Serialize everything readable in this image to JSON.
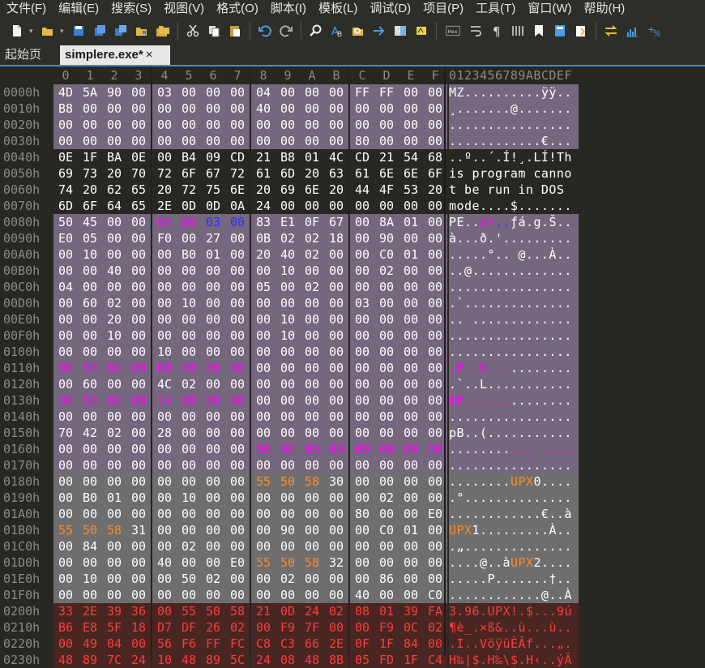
{
  "menu": [
    "文件(F)",
    "编辑(E)",
    "搜索(S)",
    "视图(V)",
    "格式(O)",
    "脚本(I)",
    "模板(L)",
    "调试(D)",
    "项目(P)",
    "工具(T)",
    "窗口(W)",
    "帮助(H)"
  ],
  "toolbar": {
    "items": [
      "new-file",
      "open-folder",
      "save",
      "save-as",
      "save-all",
      "open-project",
      "open-multiple",
      "cut",
      "copy",
      "paste",
      "undo",
      "redo",
      "find",
      "find-replace",
      "find-in-files",
      "goto",
      "compare",
      "highlight",
      "hex-mode",
      "word-wrap",
      "pilcrow",
      "columns",
      "bookmark",
      "calculator",
      "clipboard",
      "swap",
      "histogram",
      "checksum"
    ],
    "hex_label": "Hex"
  },
  "tabs": [
    {
      "label": "起始页",
      "active": false
    },
    {
      "label": "simplere.exe*",
      "active": true,
      "close": "×"
    }
  ],
  "hex": {
    "columns": [
      "0",
      "1",
      "2",
      "3",
      "4",
      "5",
      "6",
      "7",
      "8",
      "9",
      "A",
      "B",
      "C",
      "D",
      "E",
      "F"
    ],
    "ascii_header": "0123456789ABCDEF",
    "rows": [
      {
        "addr": "0000h",
        "bytes": [
          "4D",
          "5A",
          "90",
          "00",
          "03",
          "00",
          "00",
          "00",
          "04",
          "00",
          "00",
          "00",
          "FF",
          "FF",
          "00",
          "00"
        ],
        "ascii": "MZ..........ÿÿ..",
        "bg": "p"
      },
      {
        "addr": "0010h",
        "bytes": [
          "B8",
          "00",
          "00",
          "00",
          "00",
          "00",
          "00",
          "00",
          "40",
          "00",
          "00",
          "00",
          "00",
          "00",
          "00",
          "00"
        ],
        "ascii": "¸.......@.......",
        "bg": "p"
      },
      {
        "addr": "0020h",
        "bytes": [
          "00",
          "00",
          "00",
          "00",
          "00",
          "00",
          "00",
          "00",
          "00",
          "00",
          "00",
          "00",
          "00",
          "00",
          "00",
          "00"
        ],
        "ascii": "................",
        "bg": "p"
      },
      {
        "addr": "0030h",
        "bytes": [
          "00",
          "00",
          "00",
          "00",
          "00",
          "00",
          "00",
          "00",
          "00",
          "00",
          "00",
          "00",
          "80",
          "00",
          "00",
          "00"
        ],
        "ascii": "............€...",
        "bg": "p"
      },
      {
        "addr": "0040h",
        "bytes": [
          "0E",
          "1F",
          "BA",
          "0E",
          "00",
          "B4",
          "09",
          "CD",
          "21",
          "B8",
          "01",
          "4C",
          "CD",
          "21",
          "54",
          "68"
        ],
        "ascii": "..º..´.Í!¸.LÍ!Th",
        "bg": "n"
      },
      {
        "addr": "0050h",
        "bytes": [
          "69",
          "73",
          "20",
          "70",
          "72",
          "6F",
          "67",
          "72",
          "61",
          "6D",
          "20",
          "63",
          "61",
          "6E",
          "6E",
          "6F"
        ],
        "ascii": "is program canno",
        "bg": "n"
      },
      {
        "addr": "0060h",
        "bytes": [
          "74",
          "20",
          "62",
          "65",
          "20",
          "72",
          "75",
          "6E",
          "20",
          "69",
          "6E",
          "20",
          "44",
          "4F",
          "53",
          "20"
        ],
        "ascii": "t be run in DOS ",
        "bg": "n"
      },
      {
        "addr": "0070h",
        "bytes": [
          "6D",
          "6F",
          "64",
          "65",
          "2E",
          "0D",
          "0D",
          "0A",
          "24",
          "00",
          "00",
          "00",
          "00",
          "00",
          "00",
          "00"
        ],
        "ascii": "mode....$.......",
        "bg": "n"
      },
      {
        "addr": "0080h",
        "bytes": [
          "50",
          "45",
          "00",
          "00",
          "64",
          "86",
          "03",
          "00",
          "83",
          "E1",
          "0F",
          "67",
          "00",
          "8A",
          "01",
          "00"
        ],
        "ascii": "PE..d†..ƒá.g.Š..",
        "bg": "p",
        "colors": {
          "4": "m",
          "5": "m",
          "6": "b",
          "7": "b"
        },
        "acolors": {
          "4": "m",
          "5": "m",
          "6": "b",
          "7": "b"
        }
      },
      {
        "addr": "0090h",
        "bytes": [
          "E0",
          "05",
          "00",
          "00",
          "F0",
          "00",
          "27",
          "00",
          "0B",
          "02",
          "02",
          "18",
          "00",
          "90",
          "00",
          "00"
        ],
        "ascii": "à...ð.'.........",
        "bg": "p"
      },
      {
        "addr": "00A0h",
        "bytes": [
          "00",
          "10",
          "00",
          "00",
          "00",
          "B0",
          "01",
          "00",
          "20",
          "40",
          "02",
          "00",
          "00",
          "C0",
          "01",
          "00"
        ],
        "ascii": ".....°.. @...À..",
        "bg": "p"
      },
      {
        "addr": "00B0h",
        "bytes": [
          "00",
          "00",
          "40",
          "00",
          "00",
          "00",
          "00",
          "00",
          "00",
          "10",
          "00",
          "00",
          "00",
          "02",
          "00",
          "00"
        ],
        "ascii": "..@.............",
        "bg": "p"
      },
      {
        "addr": "00C0h",
        "bytes": [
          "04",
          "00",
          "00",
          "00",
          "00",
          "00",
          "00",
          "00",
          "05",
          "00",
          "02",
          "00",
          "00",
          "00",
          "00",
          "00"
        ],
        "ascii": "................",
        "bg": "p"
      },
      {
        "addr": "00D0h",
        "bytes": [
          "00",
          "60",
          "02",
          "00",
          "00",
          "10",
          "00",
          "00",
          "00",
          "00",
          "00",
          "00",
          "03",
          "00",
          "00",
          "00"
        ],
        "ascii": ".`..............",
        "bg": "p"
      },
      {
        "addr": "00E0h",
        "bytes": [
          "00",
          "00",
          "20",
          "00",
          "00",
          "00",
          "00",
          "00",
          "00",
          "10",
          "00",
          "00",
          "00",
          "00",
          "00",
          "00"
        ],
        "ascii": ".. .............",
        "bg": "p"
      },
      {
        "addr": "00F0h",
        "bytes": [
          "00",
          "00",
          "10",
          "00",
          "00",
          "00",
          "00",
          "00",
          "00",
          "10",
          "00",
          "00",
          "00",
          "00",
          "00",
          "00"
        ],
        "ascii": "................",
        "bg": "p"
      },
      {
        "addr": "0100h",
        "bytes": [
          "00",
          "00",
          "00",
          "00",
          "10",
          "00",
          "00",
          "00",
          "00",
          "00",
          "00",
          "00",
          "00",
          "00",
          "00",
          "00"
        ],
        "ascii": "................",
        "bg": "p"
      },
      {
        "addr": "0110h",
        "bytes": [
          "00",
          "50",
          "02",
          "00",
          "D0",
          "00",
          "00",
          "00",
          "00",
          "00",
          "00",
          "00",
          "00",
          "00",
          "00",
          "00"
        ],
        "ascii": ".P..Ð...........",
        "bg": "p",
        "colors": {
          "0": "m",
          "1": "m",
          "2": "m",
          "3": "m",
          "4": "m",
          "5": "m",
          "6": "m",
          "7": "m"
        },
        "acolors": {
          "0": "m",
          "1": "m",
          "2": "m",
          "3": "m",
          "4": "m",
          "5": "m",
          "6": "m",
          "7": "m"
        }
      },
      {
        "addr": "0120h",
        "bytes": [
          "00",
          "60",
          "00",
          "00",
          "4C",
          "02",
          "00",
          "00",
          "00",
          "00",
          "00",
          "00",
          "00",
          "00",
          "00",
          "00"
        ],
        "ascii": ".`..L...........",
        "bg": "p"
      },
      {
        "addr": "0130h",
        "bytes": [
          "D0",
          "50",
          "02",
          "00",
          "14",
          "00",
          "00",
          "00",
          "00",
          "00",
          "00",
          "00",
          "00",
          "00",
          "00",
          "00"
        ],
        "ascii": "ÐP..............",
        "bg": "p",
        "colors": {
          "0": "m",
          "1": "m",
          "2": "m",
          "3": "m",
          "4": "m",
          "5": "m",
          "6": "m",
          "7": "m"
        },
        "acolors": {
          "0": "m",
          "1": "m",
          "2": "m",
          "3": "m",
          "4": "m",
          "5": "m",
          "6": "m",
          "7": "m"
        }
      },
      {
        "addr": "0140h",
        "bytes": [
          "00",
          "00",
          "00",
          "00",
          "00",
          "00",
          "00",
          "00",
          "00",
          "00",
          "00",
          "00",
          "00",
          "00",
          "00",
          "00"
        ],
        "ascii": "................",
        "bg": "p"
      },
      {
        "addr": "0150h",
        "bytes": [
          "70",
          "42",
          "02",
          "00",
          "28",
          "00",
          "00",
          "00",
          "00",
          "00",
          "00",
          "00",
          "00",
          "00",
          "00",
          "00"
        ],
        "ascii": "pB..(...........",
        "bg": "p"
      },
      {
        "addr": "0160h",
        "bytes": [
          "00",
          "00",
          "00",
          "00",
          "00",
          "00",
          "00",
          "00",
          "00",
          "00",
          "00",
          "00",
          "00",
          "00",
          "00",
          "00"
        ],
        "ascii": "................",
        "bg": "p",
        "colors": {
          "8": "m",
          "9": "m",
          "10": "m",
          "11": "m",
          "12": "m",
          "13": "m",
          "14": "m",
          "15": "m"
        },
        "acolors": {
          "8": "m",
          "9": "m",
          "10": "m",
          "11": "m",
          "12": "m",
          "13": "m",
          "14": "m",
          "15": "m"
        }
      },
      {
        "addr": "0170h",
        "bytes": [
          "00",
          "00",
          "00",
          "00",
          "00",
          "00",
          "00",
          "00",
          "00",
          "00",
          "00",
          "00",
          "00",
          "00",
          "00",
          "00"
        ],
        "ascii": "................",
        "bg": "p"
      },
      {
        "addr": "0180h",
        "bytes": [
          "00",
          "00",
          "00",
          "00",
          "00",
          "00",
          "00",
          "00",
          "55",
          "50",
          "58",
          "30",
          "00",
          "00",
          "00",
          "00"
        ],
        "ascii": "........UPX0....",
        "bg": "g",
        "colors": {
          "8": "o",
          "9": "o",
          "10": "o"
        },
        "acolors": {
          "8": "o",
          "9": "o",
          "10": "o"
        }
      },
      {
        "addr": "0190h",
        "bytes": [
          "00",
          "B0",
          "01",
          "00",
          "00",
          "10",
          "00",
          "00",
          "00",
          "00",
          "00",
          "00",
          "00",
          "02",
          "00",
          "00"
        ],
        "ascii": ".°..............",
        "bg": "g"
      },
      {
        "addr": "01A0h",
        "bytes": [
          "00",
          "00",
          "00",
          "00",
          "00",
          "00",
          "00",
          "00",
          "00",
          "00",
          "00",
          "00",
          "80",
          "00",
          "00",
          "E0"
        ],
        "ascii": "............€..à",
        "bg": "g"
      },
      {
        "addr": "01B0h",
        "bytes": [
          "55",
          "50",
          "58",
          "31",
          "00",
          "00",
          "00",
          "00",
          "00",
          "90",
          "00",
          "00",
          "00",
          "C0",
          "01",
          "00"
        ],
        "ascii": "UPX1.........À..",
        "bg": "g",
        "colors": {
          "0": "o",
          "1": "o",
          "2": "o"
        },
        "acolors": {
          "0": "o",
          "1": "o",
          "2": "o"
        }
      },
      {
        "addr": "01C0h",
        "bytes": [
          "00",
          "84",
          "00",
          "00",
          "00",
          "02",
          "00",
          "00",
          "00",
          "00",
          "00",
          "00",
          "00",
          "00",
          "00",
          "00"
        ],
        "ascii": ".„..............",
        "bg": "g"
      },
      {
        "addr": "01D0h",
        "bytes": [
          "00",
          "00",
          "00",
          "00",
          "40",
          "00",
          "00",
          "E0",
          "55",
          "50",
          "58",
          "32",
          "00",
          "00",
          "00",
          "00"
        ],
        "ascii": "....@..àUPX2....",
        "bg": "g",
        "colors": {
          "8": "o",
          "9": "o",
          "10": "o"
        },
        "acolors": {
          "8": "o",
          "9": "o",
          "10": "o"
        }
      },
      {
        "addr": "01E0h",
        "bytes": [
          "00",
          "10",
          "00",
          "00",
          "00",
          "50",
          "02",
          "00",
          "00",
          "02",
          "00",
          "00",
          "00",
          "86",
          "00",
          "00"
        ],
        "ascii": ".....P.......†..",
        "bg": "g"
      },
      {
        "addr": "01F0h",
        "bytes": [
          "00",
          "00",
          "00",
          "00",
          "00",
          "00",
          "00",
          "00",
          "00",
          "00",
          "00",
          "00",
          "40",
          "00",
          "00",
          "C0"
        ],
        "ascii": "............@..À",
        "bg": "g"
      },
      {
        "addr": "0200h",
        "bytes": [
          "33",
          "2E",
          "39",
          "36",
          "00",
          "55",
          "50",
          "58",
          "21",
          "0D",
          "24",
          "02",
          "08",
          "01",
          "39",
          "FA"
        ],
        "ascii": "3.96.UPX!.$...9ú",
        "bg": "r",
        "all": "r"
      },
      {
        "addr": "0210h",
        "bytes": [
          "B6",
          "E8",
          "5F",
          "18",
          "D7",
          "DF",
          "26",
          "02",
          "00",
          "F9",
          "7F",
          "00",
          "00",
          "F9",
          "0C",
          "02"
        ],
        "ascii": "¶è_.×ß&..ù...ù..",
        "bg": "r",
        "all": "r"
      },
      {
        "addr": "0220h",
        "bytes": [
          "00",
          "49",
          "04",
          "00",
          "56",
          "F6",
          "FF",
          "FC",
          "C8",
          "C3",
          "66",
          "2E",
          "0F",
          "1F",
          "84",
          "00"
        ],
        "ascii": ".I..VöÿüÈÃf...„.",
        "bg": "r",
        "all": "r"
      },
      {
        "addr": "0230h",
        "bytes": [
          "48",
          "89",
          "7C",
          "24",
          "10",
          "48",
          "89",
          "5C",
          "24",
          "08",
          "48",
          "8B",
          "05",
          "FD",
          "1F",
          "C4"
        ],
        "ascii": "H‰|$.H‰\\$.H‹..ýÄ",
        "bg": "r",
        "all": "r"
      }
    ]
  }
}
